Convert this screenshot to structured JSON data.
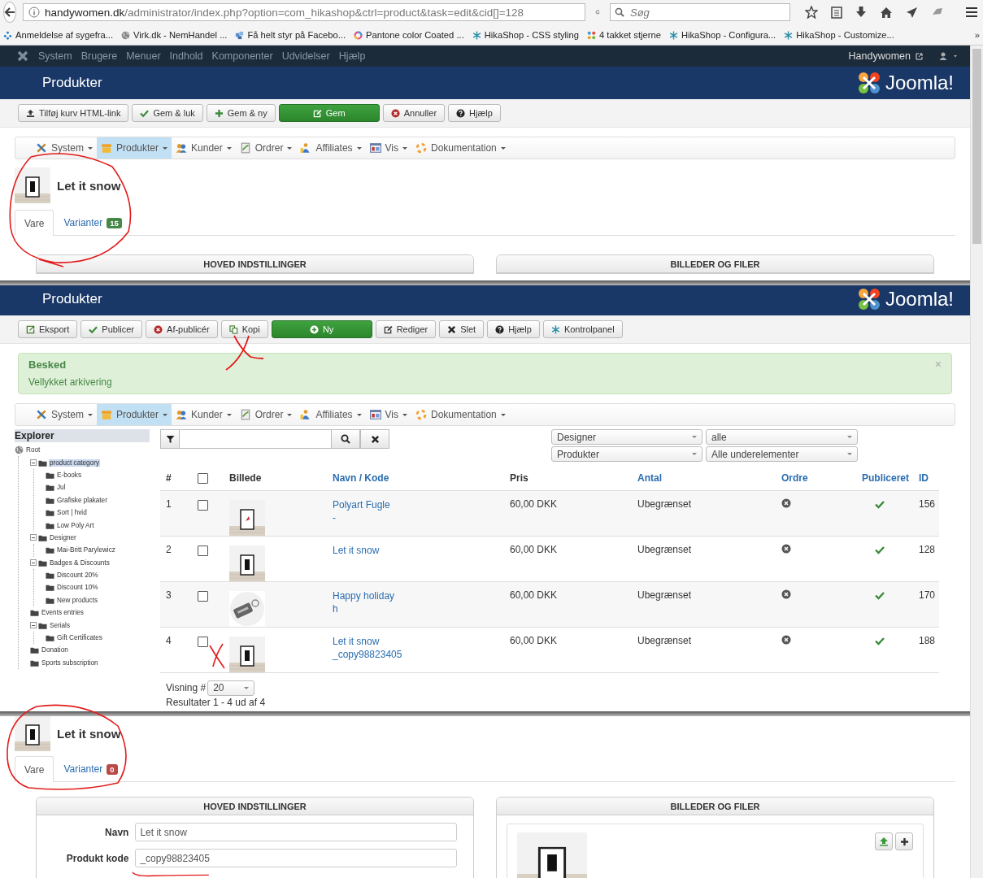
{
  "browser": {
    "url_host": "handywomen.dk",
    "url_path": "/administrator/index.php?option=com_hikashop&ctrl=product&task=edit&cid[]=128",
    "search": {
      "placeholder": "Søg"
    },
    "bookmarks": [
      {
        "label": "Anmeldelse af sygefra..."
      },
      {
        "label": "Virk.dk - NemHandel ..."
      },
      {
        "label": "Få helt styr på Facebo..."
      },
      {
        "label": "Pantone color Coated ..."
      },
      {
        "label": "HikaShop - CSS styling"
      },
      {
        "label": "4 takket stjerne"
      },
      {
        "label": "HikaShop - Configura..."
      },
      {
        "label": "HikaShop - Customize..."
      }
    ],
    "more": "»"
  },
  "admin_menu": {
    "items": [
      "System",
      "Brugere",
      "Menuer",
      "Indhold",
      "Komponenter",
      "Udvidelser",
      "Hjælp"
    ],
    "user": "Handywomen"
  },
  "product_edit_top": {
    "header": {
      "title": "Produkter",
      "logo_text": "Joomla!"
    },
    "toolbar": [
      {
        "label": "Tilføj kurv HTML-link",
        "kind": "default"
      },
      {
        "label": "Gem & luk",
        "kind": "default"
      },
      {
        "label": "Gem & ny",
        "kind": "default"
      },
      {
        "label": "Gem",
        "kind": "primary"
      },
      {
        "label": "Annuller",
        "kind": "default"
      },
      {
        "label": "Hjælp",
        "kind": "default"
      }
    ],
    "submenu": [
      {
        "label": "System",
        "selected": false
      },
      {
        "label": "Produkter",
        "selected": true
      },
      {
        "label": "Kunder",
        "selected": false
      },
      {
        "label": "Ordrer",
        "selected": false
      },
      {
        "label": "Affiliates",
        "selected": false
      },
      {
        "label": "Vis",
        "selected": false
      },
      {
        "label": "Dokumentation",
        "selected": false
      }
    ],
    "product": {
      "name": "Let it snow"
    },
    "tabs": [
      {
        "label": "Vare",
        "selected": true
      },
      {
        "label": "Varianter",
        "selected": false,
        "badge": "15",
        "color": "#468847"
      }
    ],
    "panels": [
      "HOVED INDSTILLINGER",
      "BILLEDER OG FILER"
    ]
  },
  "product_list": {
    "header": {
      "title": "Produkter",
      "logo_text": "Joomla!"
    },
    "toolbar": [
      {
        "label": "Eksport",
        "kind": "default"
      },
      {
        "label": "Publicer",
        "kind": "default"
      },
      {
        "label": "Af-publicér",
        "kind": "default"
      },
      {
        "label": "Kopi",
        "kind": "default"
      },
      {
        "label": "Ny",
        "kind": "primary"
      },
      {
        "label": "Rediger",
        "kind": "default"
      },
      {
        "label": "Slet",
        "kind": "default"
      },
      {
        "label": "Hjælp",
        "kind": "default"
      },
      {
        "label": "Kontrolpanel",
        "kind": "default"
      }
    ],
    "message": {
      "title": "Besked",
      "text": "Vellykket arkivering",
      "close": "×"
    },
    "submenu": [
      {
        "label": "System",
        "selected": false
      },
      {
        "label": "Produkter",
        "selected": true
      },
      {
        "label": "Kunder",
        "selected": false
      },
      {
        "label": "Ordrer",
        "selected": false
      },
      {
        "label": "Affiliates",
        "selected": false
      },
      {
        "label": "Vis",
        "selected": false
      },
      {
        "label": "Dokumentation",
        "selected": false
      }
    ],
    "explorer": {
      "title": "Explorer",
      "tree": [
        {
          "label": "Root",
          "selected": false,
          "children": [
            {
              "label": "product category",
              "selected": true,
              "children": [
                {
                  "label": "E-books",
                  "selected": false
                },
                {
                  "label": "Jul",
                  "selected": false
                },
                {
                  "label": "Grafiske plakater",
                  "selected": false
                },
                {
                  "label": "Sort | hvid",
                  "selected": false
                },
                {
                  "label": "Low Poly Art",
                  "selected": false
                }
              ]
            },
            {
              "label": "Designer",
              "selected": false,
              "children": [
                {
                  "label": "Mai-Britt Parylewicz",
                  "selected": false
                }
              ]
            },
            {
              "label": "Badges & Discounts",
              "selected": false,
              "children": [
                {
                  "label": "Discount 20%",
                  "selected": false
                },
                {
                  "label": "Discount 10%",
                  "selected": false
                },
                {
                  "label": "New products",
                  "selected": false
                }
              ]
            },
            {
              "label": "Events entries",
              "selected": false
            },
            {
              "label": "Serials",
              "selected": false,
              "children": [
                {
                  "label": "Gift Certificates",
                  "selected": false
                }
              ]
            },
            {
              "label": "Donation",
              "selected": false
            },
            {
              "label": "Sports subscription",
              "selected": false
            }
          ]
        }
      ]
    },
    "filters": [
      "Designer",
      "alle",
      "Produkter",
      "Alle underelementer"
    ],
    "table": {
      "columns": [
        {
          "label": "#",
          "kind": "text",
          "sortable": false
        },
        {
          "kind": "checkbox",
          "checked": false
        },
        {
          "label": "Billede",
          "kind": "text",
          "sortable": false
        },
        {
          "label": "Navn / Kode",
          "kind": "text",
          "sortable": true
        },
        {
          "label": "Pris",
          "kind": "text",
          "sortable": false
        },
        {
          "label": "Antal",
          "kind": "text",
          "sortable": true
        },
        {
          "label": "Ordre",
          "kind": "text",
          "sortable": true
        },
        {
          "label": "Publiceret",
          "kind": "text",
          "sortable": true
        },
        {
          "label": "ID",
          "kind": "text",
          "sortable": true
        }
      ],
      "rows": [
        {
          "num": "1",
          "checked": false,
          "name": "Polyart Fugle",
          "code": "-",
          "price": "60,00 DKK",
          "quantity": "Ubegrænset",
          "published": true,
          "id": "156"
        },
        {
          "num": "2",
          "checked": false,
          "name": "Let it snow",
          "price": "60,00 DKK",
          "quantity": "Ubegrænset",
          "published": true,
          "id": "128"
        },
        {
          "num": "3",
          "checked": false,
          "name": "Happy holiday",
          "code": "h",
          "price": "60,00 DKK",
          "quantity": "Ubegrænset",
          "published": true,
          "id": "170"
        },
        {
          "num": "4",
          "checked": false,
          "name": "Let it snow",
          "code": "_copy98823405",
          "price": "60,00 DKK",
          "quantity": "Ubegrænset",
          "published": true,
          "id": "188"
        }
      ]
    },
    "pagination": {
      "label": "Visning #",
      "value": "20",
      "results": "Resultater 1 - 4 ud af 4"
    }
  },
  "product_edit_bottom": {
    "product": {
      "name": "Let it snow"
    },
    "tabs": [
      {
        "label": "Vare",
        "selected": true
      },
      {
        "label": "Varianter",
        "selected": false,
        "badge": "0",
        "color": "#b94a48"
      }
    ],
    "panels": [
      "HOVED INDSTILLINGER",
      "BILLEDER OG FILER"
    ],
    "fields": [
      {
        "label": "Navn",
        "value": "Let it snow"
      },
      {
        "label": "Produkt kode",
        "value": "_copy98823405"
      }
    ]
  }
}
